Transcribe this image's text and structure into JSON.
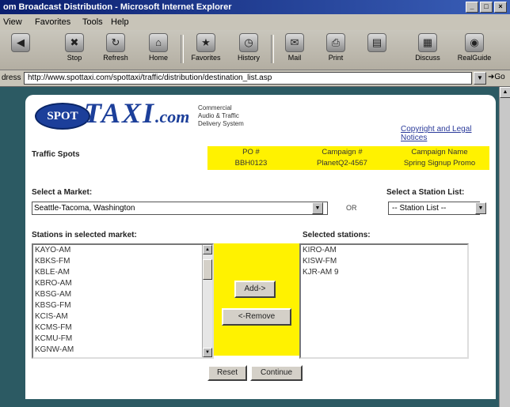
{
  "window": {
    "title": "om Broadcast Distribution - Microsoft Internet Explorer",
    "controls": [
      "_",
      "□",
      "×"
    ]
  },
  "menu": [
    "View",
    "Favorites",
    "Tools",
    "Help"
  ],
  "toolbar": {
    "buttons": [
      {
        "label": "Stop",
        "icon": "stop-icon"
      },
      {
        "label": "Refresh",
        "icon": "refresh-icon"
      },
      {
        "label": "Home",
        "icon": "home-icon"
      },
      {
        "label": "Favorites",
        "icon": "favorites-icon"
      },
      {
        "label": "History",
        "icon": "history-icon"
      },
      {
        "label": "Mail",
        "icon": "mail-icon"
      },
      {
        "label": "Print",
        "icon": "print-icon"
      },
      {
        "label": "",
        "icon": "edit-icon"
      },
      {
        "label": "Discuss",
        "icon": "discuss-icon"
      },
      {
        "label": "RealGuide",
        "icon": "realguide-icon"
      }
    ]
  },
  "address": {
    "label": "dress",
    "url": "http://www.spottaxi.com/spottaxi/traffic/distribution/destination_list.asp",
    "go_label": "Go"
  },
  "brand": {
    "spot": "SPOT",
    "taxi": "TAXI",
    "dotcom": ".com",
    "tagline": [
      "Commercial",
      "Audio & Traffic",
      "Delivery System"
    ]
  },
  "links": {
    "copyright": "Copyright and Legal Notices"
  },
  "page": {
    "section_title": "Traffic Spots"
  },
  "po_table": {
    "headers": [
      "PO #",
      "Campaign #",
      "Campaign Name"
    ],
    "row": [
      "BBH0123",
      "PlanetQ2-4567",
      "Spring Signup Promo"
    ]
  },
  "market": {
    "label": "Select a Market:",
    "selected": "Seattle-Tacoma, Washington"
  },
  "or_label": "OR",
  "station_list": {
    "label": "Select a Station List:",
    "selected": "-- Station List --"
  },
  "stations": {
    "label": "Stations in selected market:",
    "items": [
      "KAYO-AM",
      "KBKS-FM",
      "KBLE-AM",
      "KBRO-AM",
      "KBSG-AM",
      "KBSG-FM",
      "KCIS-AM",
      "KCMS-FM",
      "KCMU-FM",
      "KGNW-AM"
    ]
  },
  "selected": {
    "label": "Selected stations:",
    "items": [
      "KIRO-AM",
      "KISW-FM",
      "KJR-AM 9"
    ]
  },
  "buttons": {
    "add": "Add->",
    "remove": "<-Remove",
    "reset": "Reset",
    "continue": "Continue"
  },
  "colors": {
    "yellow": "#fff200",
    "brand_blue": "#1c3f9a",
    "page_bg": "#2c5a63"
  }
}
